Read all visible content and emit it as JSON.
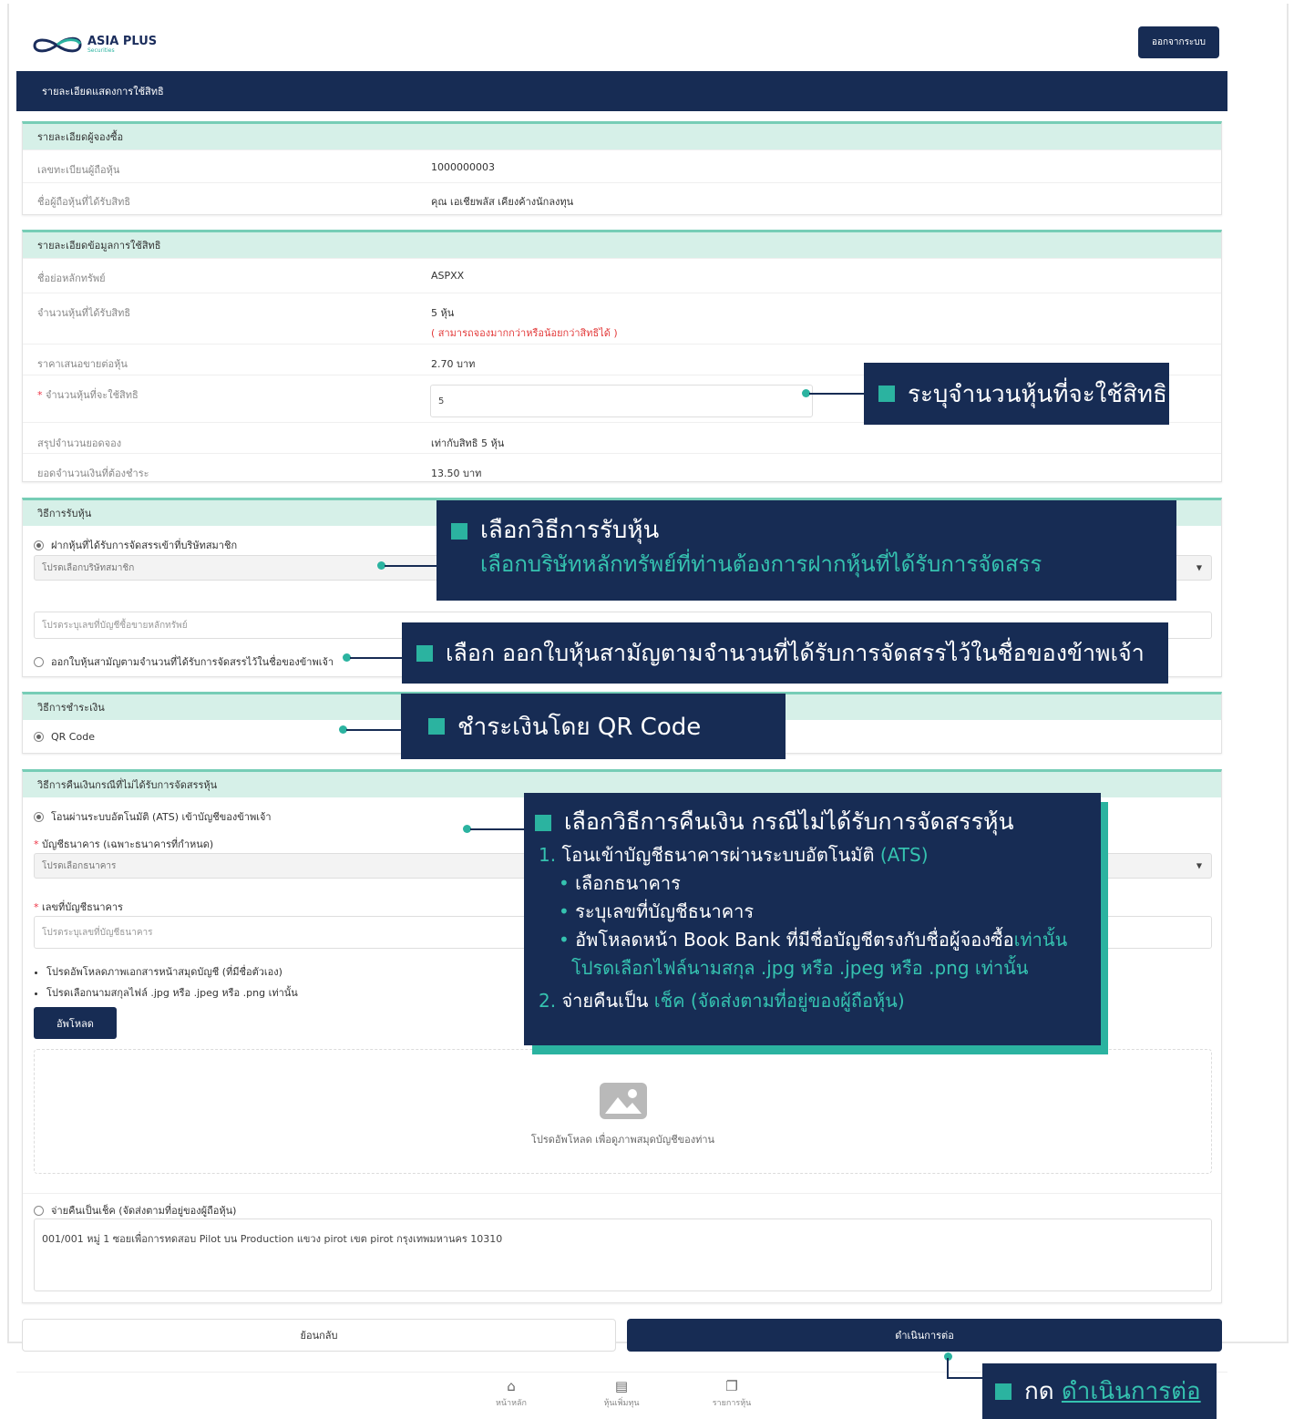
{
  "header": {
    "logo_text": "ASIA PLUS",
    "logo_sub": "Securities",
    "logout_label": "ออกจากระบบ",
    "page_title": "รายละเอียดแสดงการใช้สิทธิ"
  },
  "subscriber": {
    "title": "รายละเอียดผู้จองซื้อ",
    "rows": [
      {
        "label": "เลขทะเบียนผู้ถือหุ้น",
        "value": "1000000003"
      },
      {
        "label": "ชื่อผู้ถือหุ้นที่ได้รับสิทธิ",
        "value": "คุณ เอเชียพลัส เคียงค้างนักลงทุน"
      }
    ]
  },
  "rights": {
    "title": "รายละเอียดข้อมูลการใช้สิทธิ",
    "symbol_label": "ชื่อย่อหลักทรัพย์",
    "symbol_value": "ASPXX",
    "entitled_label": "จำนวนหุ้นที่ได้รับสิทธิ",
    "entitled_value": "5 หุ้น",
    "entitled_note": "( สามารถจองมากกว่าหรือน้อยกว่าสิทธิได้ )",
    "price_label": "ราคาเสนอขายต่อหุ้น",
    "price_value": "2.70 บาท",
    "exercise_req": "*",
    "exercise_label": "จำนวนหุ้นที่จะใช้สิทธิ",
    "exercise_value": "5",
    "summary_label": "สรุปจำนวนยอดจอง",
    "summary_value": "เท่ากับสิทธิ 5 หุ้น",
    "amount_label": "ยอดจำนวนเงินที่ต้องชำระ",
    "amount_value": "13.50 บาท"
  },
  "receive": {
    "title": "วิธีการรับหุ้น",
    "option1": "ฝากหุ้นที่ได้รับการจัดสรรเข้าที่บริษัทสมาชิก",
    "broker_placeholder": "โปรดเลือกบริษัทสมาชิก",
    "account_placeholder": "โปรดระบุเลขที่บัญชีซื้อขายหลักทรัพย์",
    "option2": "ออกใบหุ้นสามัญตามจำนวนที่ได้รับการจัดสรรไว้ในชื่อของข้าพเจ้า"
  },
  "payment": {
    "title": "วิธีการชำระเงิน",
    "option1": "QR Code"
  },
  "refund": {
    "title": "วิธีการคืนเงินกรณีที่ไม่ได้รับการจัดสรรหุ้น",
    "option1": "โอนผ่านระบบอัตโนมัติ (ATS) เข้าบัญชีของข้าพเจ้า",
    "req": "*",
    "bank_label": "บัญชีธนาคาร (เฉพาะธนาคารที่กำหนด)",
    "bank_placeholder": "โปรดเลือกธนาคาร",
    "account_label": "เลขที่บัญชีธนาคาร",
    "account_placeholder": "โปรดระบุเลขที่บัญชีธนาคาร",
    "bullets": [
      "โปรดอัพโหลดภาพเอกสารหน้าสมุดบัญชี (ที่มีชื่อตัวเอง)",
      "โปรดเลือกนามสกุลไฟล์ .jpg หรือ .jpeg หรือ .png เท่านั้น"
    ],
    "upload_label": "อัพโหลด",
    "dropzone_text": "โปรดอัพโหลด เพื่อดูภาพสมุดบัญชีของท่าน",
    "option2": "จ่ายคืนเป็นเช็ค (จัดส่งตามที่อยู่ของผู้ถือหุ้น)",
    "address": "001/001 หมู่ 1 ซอยเพื่อการทดสอบ Pilot บน Production แขวง pirot เขต pirot กรุงเทพมหานคร 10310"
  },
  "actions": {
    "back_label": "ย้อนกลับ",
    "next_label": "ดำเนินการต่อ"
  },
  "bottom_nav": [
    {
      "icon": "home-icon",
      "label": "หน้าหลัก"
    },
    {
      "icon": "document-icon",
      "label": "หุ้นเพิ่มทุน"
    },
    {
      "icon": "list-icon",
      "label": "รายการหุ้น"
    }
  ],
  "callouts": {
    "c1": "ระบุจำนวนหุ้นที่จะใช้สิทธิ",
    "c2_title": "เลือกวิธีการรับหุ้น",
    "c2_sub": "เลือกบริษัทหลักทรัพย์ที่ท่านต้องการฝากหุ้นที่ได้รับการจัดสรร",
    "c3": "เลือก ออกใบหุ้นสามัญตามจำนวนที่ได้รับการจัดสรรไว้ในชื่อของข้าพเจ้า",
    "c4": "ชำระเงินโดย QR Code",
    "c5_title": "เลือกวิธีการคืนเงิน กรณีไม่ได้รับการจัดสรรหุ้น",
    "c5_l1_num": "1.",
    "c5_l1_text": "โอนเข้าบัญชีธนาคารผ่านระบบอัตโนมัติ",
    "c5_l1_hl": "(ATS)",
    "c5_b1": "เลือกธนาคาร",
    "c5_b2": "ระบุเลขที่บัญชีธนาคาร",
    "c5_b3_text": "อัพโหลดหน้า Book Bank ที่มีชื่อบัญชีตรงกับชื่อผู้จองซื้อ",
    "c5_b3_hl": "เท่านั้น",
    "c5_b3_line2": "โปรดเลือกไฟล์นามสกุล .jpg หรือ .jpeg หรือ .png เท่านั้น",
    "c5_l2_num": "2.",
    "c5_l2_text": "จ่ายคืนเป็น",
    "c5_l2_hl": "เช็ค (จัดส่งตามที่อยู่ของผู้ถือหุ้น)",
    "c6_text": "กด",
    "c6_hl": "ดำเนินการต่อ"
  },
  "colors": {
    "navy": "#172c54",
    "teal": "#2bb3a0",
    "mint_header": "#d6f0e8",
    "red_note": "#e33b3b"
  }
}
